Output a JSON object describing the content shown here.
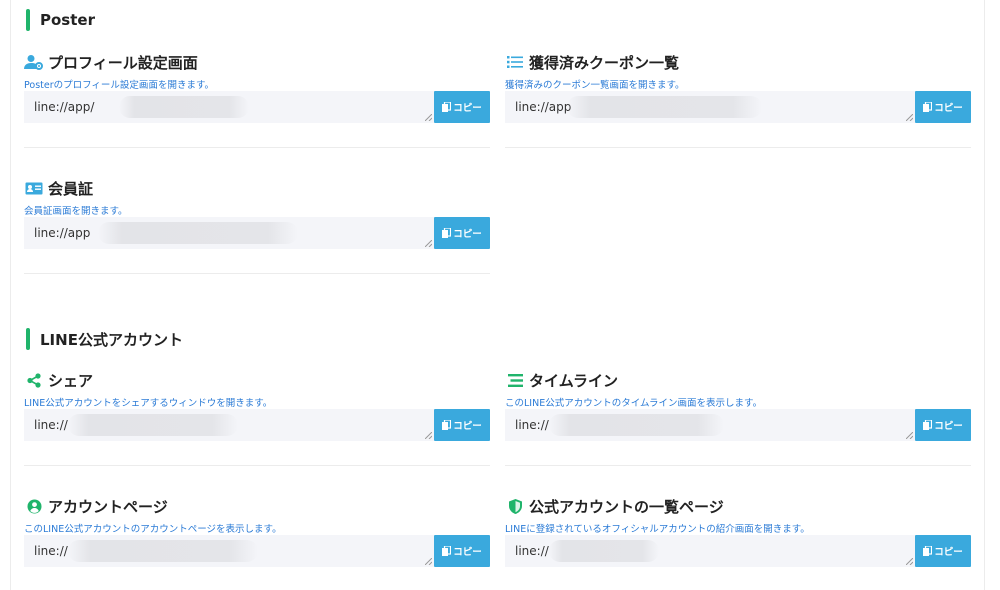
{
  "colors": {
    "accent_bar": "#20b46b",
    "description": "#2b7bd6",
    "copy_button": "#3aa9dd",
    "field_bg": "#f4f5f9"
  },
  "sections": {
    "poster": {
      "title": "Poster"
    },
    "line": {
      "title": "LINE公式アカウント"
    }
  },
  "copy_label": "コピー",
  "items": {
    "profile": {
      "icon": "user-gear-icon",
      "title": "プロフィール設定画面",
      "desc": "Posterのプロフィール設定画面を開きます。",
      "url": "line://app/"
    },
    "coupons": {
      "icon": "list-icon",
      "title": "獲得済みクーポン一覧",
      "desc": "獲得済みのクーポン一覧画面を開きます。",
      "url": "line://app"
    },
    "member": {
      "icon": "id-card-icon",
      "title": "会員証",
      "desc": "会員証画面を開きます。",
      "url": "line://app"
    },
    "share": {
      "icon": "share-icon",
      "title": "シェア",
      "desc": "LINE公式アカウントをシェアするウィンドウを開きます。",
      "url": "line://"
    },
    "timeline": {
      "icon": "timeline-icon",
      "title": "タイムライン",
      "desc": "このLINE公式アカウントのタイムライン画面を表示します。",
      "url": "line://"
    },
    "account": {
      "icon": "user-circle-icon",
      "title": "アカウントページ",
      "desc": "このLINE公式アカウントのアカウントページを表示します。",
      "url": "line://"
    },
    "official_list": {
      "icon": "shield-icon",
      "title": "公式アカウントの一覧ページ",
      "desc": "LINEに登録されているオフィシャルアカウントの紹介画面を開きます。",
      "url": "line://"
    }
  }
}
